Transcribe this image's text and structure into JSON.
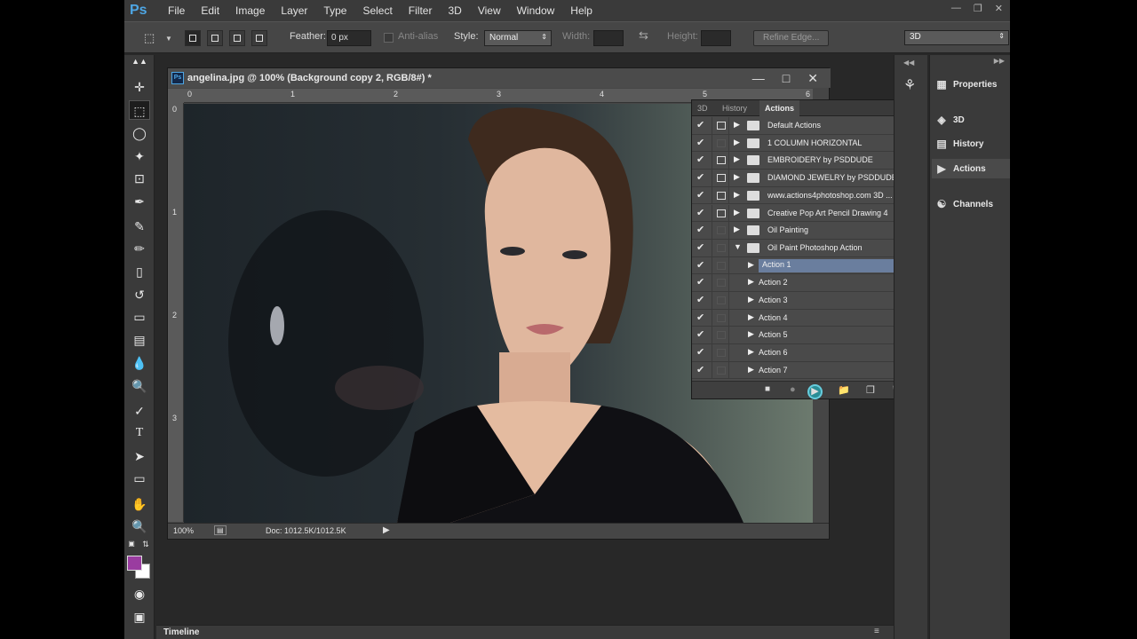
{
  "menubar": {
    "logo": "Ps",
    "items": [
      "File",
      "Edit",
      "Image",
      "Layer",
      "Type",
      "Select",
      "Filter",
      "3D",
      "View",
      "Window",
      "Help"
    ]
  },
  "options": {
    "feather_label": "Feather:",
    "feather_value": "0 px",
    "antialias_label": "Anti-alias",
    "style_label": "Style:",
    "style_value": "Normal",
    "width_label": "Width:",
    "height_label": "Height:",
    "refine_edge": "Refine Edge...",
    "workspace": "3D"
  },
  "document": {
    "title": "angelina.jpg @ 100% (Background copy 2, RGB/8#) *",
    "ruler_h": [
      "0",
      "1",
      "2",
      "3",
      "4",
      "5",
      "6"
    ],
    "ruler_v": [
      "0",
      "1",
      "2",
      "3"
    ],
    "zoom": "100%",
    "doc_size": "Doc: 1012.5K/1012.5K"
  },
  "actions_panel": {
    "tabs": [
      "3D",
      "History",
      "Actions"
    ],
    "active_tab": "Actions",
    "rows": [
      {
        "label": "Default Actions",
        "type": "set",
        "dialog": true
      },
      {
        "label": "1 COLUMN HORIZONTAL",
        "type": "set",
        "dialog": false
      },
      {
        "label": "EMBROIDERY by PSDDUDE",
        "type": "set",
        "dialog": true
      },
      {
        "label": "DIAMOND JEWELRY by PSDDUDE",
        "type": "set",
        "dialog": true
      },
      {
        "label": "www.actions4photoshop.com 3D ...",
        "type": "set",
        "dialog": true
      },
      {
        "label": "Creative Pop Art Pencil Drawing 4",
        "type": "set",
        "dialog": true
      },
      {
        "label": "Oil Painting",
        "type": "set",
        "dialog": false
      },
      {
        "label": "Oil Paint Photoshop Action",
        "type": "set-open",
        "dialog": false
      },
      {
        "label": "Action 1",
        "type": "action",
        "dialog": false,
        "selected": true
      },
      {
        "label": "Action 2",
        "type": "action",
        "dialog": false
      },
      {
        "label": "Action 3",
        "type": "action",
        "dialog": false
      },
      {
        "label": "Action 4",
        "type": "action",
        "dialog": false
      },
      {
        "label": "Action 5",
        "type": "action",
        "dialog": false
      },
      {
        "label": "Action 6",
        "type": "action",
        "dialog": false
      },
      {
        "label": "Action 7",
        "type": "action",
        "dialog": false
      }
    ]
  },
  "dock": {
    "items": [
      "Properties",
      "3D",
      "History",
      "Actions",
      "Channels"
    ],
    "active": "Actions"
  },
  "timeline": "Timeline",
  "colors": {
    "foreground": "#9a3ca0",
    "background": "#ffffff",
    "selection": "#6a7e9e"
  }
}
